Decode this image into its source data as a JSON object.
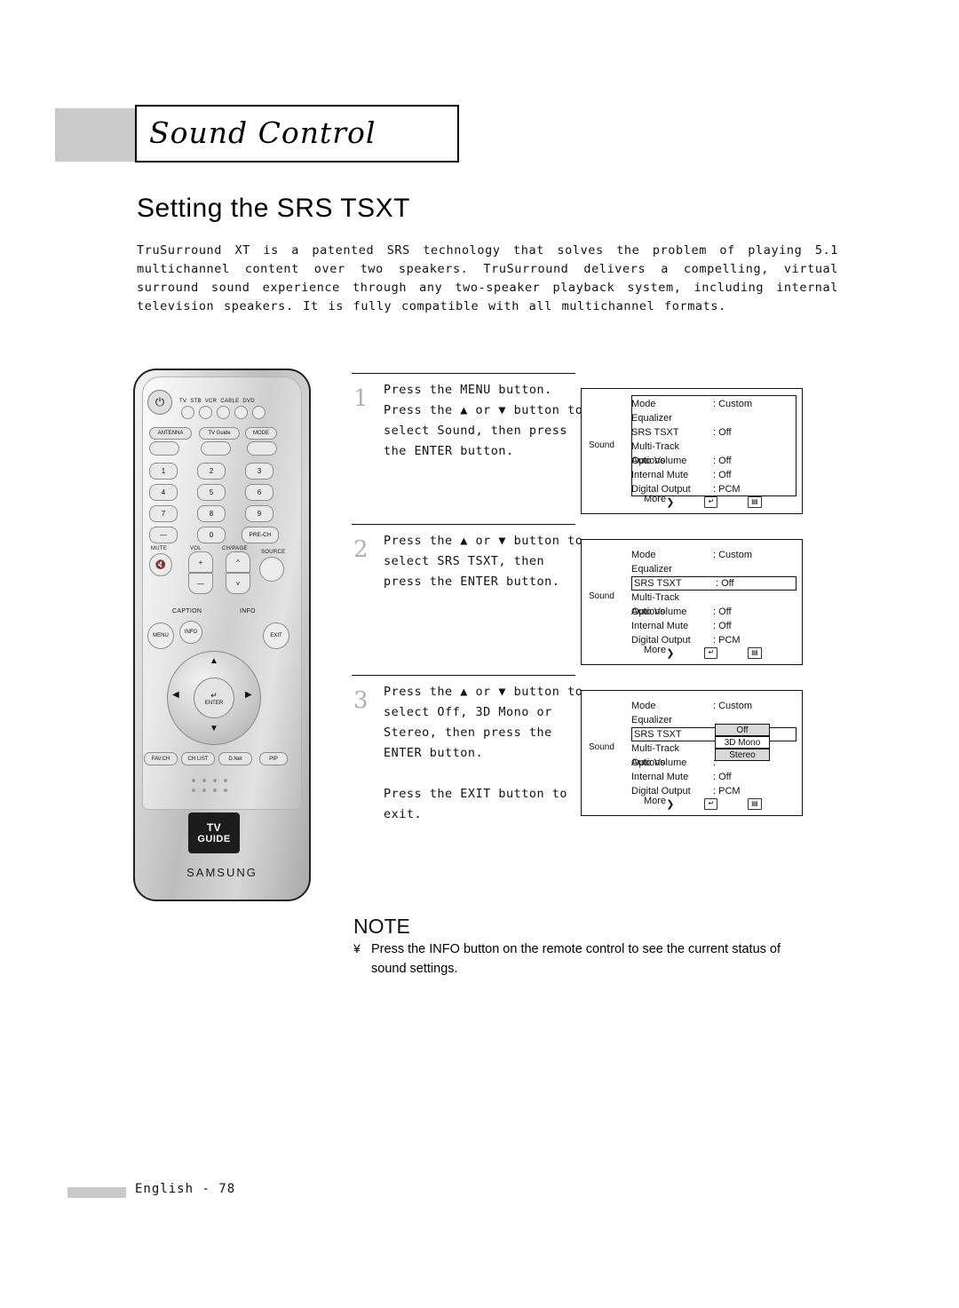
{
  "header": {
    "title": "Sound Control"
  },
  "page_title": "Setting the SRS TSXT",
  "intro": "TruSurround XT is a patented SRS technology that solves the problem of playing 5.1 multichannel content over two speakers. TruSurround delivers a compelling, virtual surround sound experience through any two-speaker playback system, including internal television speakers. It is fully compatible with all multichannel formats.",
  "steps": [
    {
      "num": "1",
      "text": "Press the MENU button.\nPress the ▲ or ▼ button to\nselect Sound, then press\nthe ENTER button."
    },
    {
      "num": "2",
      "text": "Press the ▲ or ▼ button to\nselect SRS TSXT, then\npress the ENTER button."
    },
    {
      "num": "3",
      "text": "Press the ▲ or ▼ button to\nselect Off, 3D Mono or\nStereo, then press the\nENTER button.\n\nPress the EXIT button to exit."
    }
  ],
  "osd": {
    "side_label": "Sound",
    "more_label": "More",
    "footer": {
      "move": "Move",
      "enter": "Enter",
      "return": "Return"
    },
    "screens": [
      {
        "rows": [
          {
            "label": "Mode",
            "value": ": Custom",
            "selected": false
          },
          {
            "label": "Equalizer",
            "value": "",
            "selected": false
          },
          {
            "label": "SRS TSXT",
            "value": ": Off",
            "selected": false
          },
          {
            "label": "Multi-Track Options",
            "value": "",
            "selected": false
          },
          {
            "label": "Auto Volume",
            "value": ": Off",
            "selected": false
          },
          {
            "label": "Internal Mute",
            "value": ": Off",
            "selected": false
          },
          {
            "label": "Digital Output",
            "value": ": PCM",
            "selected": false
          }
        ],
        "highlight_all": true,
        "popup": null
      },
      {
        "rows": [
          {
            "label": "Mode",
            "value": ": Custom",
            "selected": false
          },
          {
            "label": "Equalizer",
            "value": "",
            "selected": false
          },
          {
            "label": "SRS TSXT",
            "value": ": Off",
            "selected": true
          },
          {
            "label": "Multi-Track Options",
            "value": "",
            "selected": false
          },
          {
            "label": "Auto Volume",
            "value": ": Off",
            "selected": false
          },
          {
            "label": "Internal Mute",
            "value": ": Off",
            "selected": false
          },
          {
            "label": "Digital Output",
            "value": ": PCM",
            "selected": false
          }
        ],
        "highlight_all": false,
        "popup": null
      },
      {
        "rows": [
          {
            "label": "Mode",
            "value": ": Custom",
            "selected": false
          },
          {
            "label": "Equalizer",
            "value": "",
            "selected": false
          },
          {
            "label": "SRS TSXT",
            "value": "",
            "selected": true
          },
          {
            "label": "Multi-Track Options",
            "value": "",
            "selected": false
          },
          {
            "label": "Auto Volume",
            "value": ":",
            "selected": false
          },
          {
            "label": "Internal Mute",
            "value": ": Off",
            "selected": false
          },
          {
            "label": "Digital Output",
            "value": ": PCM",
            "selected": false
          }
        ],
        "highlight_all": false,
        "popup": {
          "options": [
            "Off",
            "3D Mono",
            "Stereo"
          ],
          "selected": "Off"
        }
      }
    ]
  },
  "note": {
    "title": "NOTE",
    "bullet": "¥",
    "text": "Press the INFO button on the remote control to see the current status of sound settings."
  },
  "footer": {
    "page": "English - 78"
  },
  "remote": {
    "power_icon": "power-icon",
    "device_buttons": [
      "TV",
      "STB",
      "VCR",
      "CABLE",
      "DVD"
    ],
    "antenna_label": "ANTENNA",
    "tvguide_label": "TV Guide",
    "mode_label": "MODE",
    "keypad": [
      "1",
      "2",
      "3",
      "4",
      "5",
      "6",
      "7",
      "8",
      "9",
      "—",
      "0",
      "PRE-CH"
    ],
    "mute_label": "MUTE",
    "vol_label": "VOL",
    "ch_label": "CH/PAGE",
    "source_label": "SOURCE",
    "menu_label": "MENU",
    "info_label": "INFO",
    "exit_label": "EXIT",
    "enter_label": "ENTER",
    "bottom_buttons": [
      "FAV.CH",
      "CH LIST",
      "D.Net",
      "PIP"
    ],
    "logo_text": "TV",
    "logo_sub": "GUIDE",
    "brand": "SAMSUNG"
  }
}
